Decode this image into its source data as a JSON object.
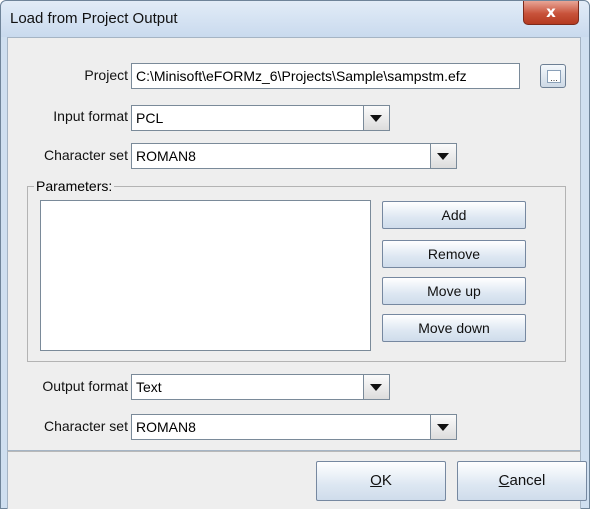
{
  "window": {
    "title": "Load from Project Output",
    "close_glyph": "x"
  },
  "project": {
    "label": "Project",
    "value": "C:\\Minisoft\\eFORMz_6\\Projects\\Sample\\sampstm.efz",
    "browse_glyph": "..."
  },
  "input": {
    "format_label": "Input format",
    "format_value": "PCL",
    "charset_label": "Character set",
    "charset_value": "ROMAN8"
  },
  "parameters": {
    "legend": "Parameters:",
    "items": [],
    "buttons": {
      "add": "Add",
      "remove": "Remove",
      "move_up": "Move up",
      "move_down": "Move down"
    }
  },
  "output": {
    "format_label": "Output format",
    "format_value": "Text",
    "charset_label": "Character set",
    "charset_value": "ROMAN8"
  },
  "footer": {
    "ok_mnemonic": "O",
    "ok_rest": "K",
    "cancel_mnemonic": "C",
    "cancel_rest": "ancel"
  },
  "colors": {
    "close_button": "#c8523a",
    "titlebar": "#cfdff0",
    "panel": "#eeeeee"
  },
  "icons": {
    "close": "close-icon",
    "browse": "ellipsis-icon",
    "dropdown": "chevron-down-icon"
  }
}
